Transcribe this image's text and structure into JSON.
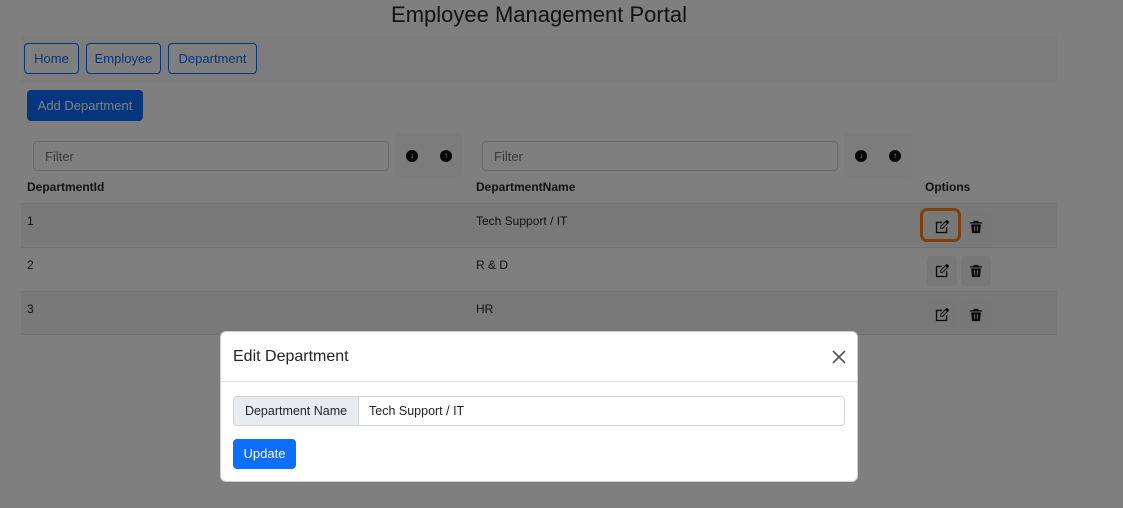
{
  "app": {
    "title": "Employee Management Portal"
  },
  "nav": {
    "home": "Home",
    "employee": "Employee",
    "department": "Department"
  },
  "actions": {
    "add_department": "Add Department"
  },
  "filters": {
    "id_placeholder": "Filter",
    "name_placeholder": "Filter"
  },
  "table": {
    "headers": {
      "id": "DepartmentId",
      "name": "DepartmentName",
      "options": "Options"
    },
    "rows": [
      {
        "id": "1",
        "name": "Tech Support / IT"
      },
      {
        "id": "2",
        "name": "R & D"
      },
      {
        "id": "3",
        "name": "HR"
      }
    ]
  },
  "modal": {
    "title": "Edit Department",
    "field_label": "Department Name",
    "field_value": "Tech Support / IT",
    "submit_label": "Update"
  },
  "colors": {
    "primary": "#0d6efd",
    "highlight": "#fd7e14",
    "backdrop": "rgba(0,0,0,0.5)"
  },
  "icons": {
    "sort_desc": "arrow-down-circle-icon",
    "sort_asc": "arrow-up-circle-icon",
    "edit": "pencil-square-icon",
    "delete": "trash-icon",
    "close": "close-icon"
  }
}
